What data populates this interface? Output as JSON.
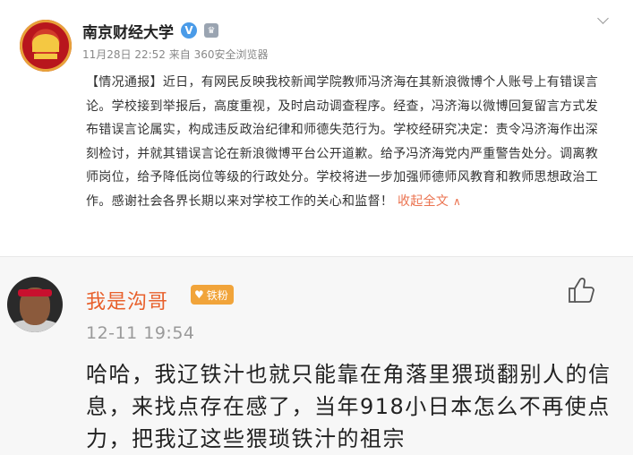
{
  "post": {
    "author": "南京财经大学",
    "verified_glyph": "V",
    "vip_glyph": "♛",
    "meta": "11月28日 22:52 来自 360安全浏览器",
    "tag": "【情况通报】",
    "body": "近日，有网民反映我校新闻学院教师冯济海在其新浪微博个人账号上有错误言论。学校接到举报后，高度重视，及时启动调查程序。经查，冯济海以微博回复留言方式发布错误言论属实，构成违反政治纪律和师德失范行为。学校经研究决定：责令冯济海作出深刻检讨，并就其错误言论在新浪微博平台公开道歉。给予冯济海党内严重警告处分。调离教师岗位，给予降低岗位等级的行政处分。学校将进一步加强师德师风教育和教师思想政治工作。感谢社会各界长期以来对学校工作的关心和监督！",
    "collapse_label": "收起全文",
    "collapse_icon": "∧"
  },
  "comment": {
    "author": "我是沟哥",
    "badge_icon": "♥",
    "badge_label": "铁粉",
    "time": "12-11 19:54",
    "text": "哈哈，我辽铁汁也就只能靠在角落里猥琐翻别人的信息，来找点存在感了，当年918小日本怎么不再使点力，把我辽这些猥琐铁汁的祖宗"
  },
  "colors": {
    "accent_orange": "#eb7350",
    "username_orange": "#e8602c",
    "badge_gold": "#f1a43a",
    "verified_blue": "#4a9be8"
  },
  "icons": {
    "post_menu": "chevron-down-icon",
    "like": "thumbs-up-icon",
    "verified": "verified-icon",
    "vip": "vip-crown-icon"
  }
}
